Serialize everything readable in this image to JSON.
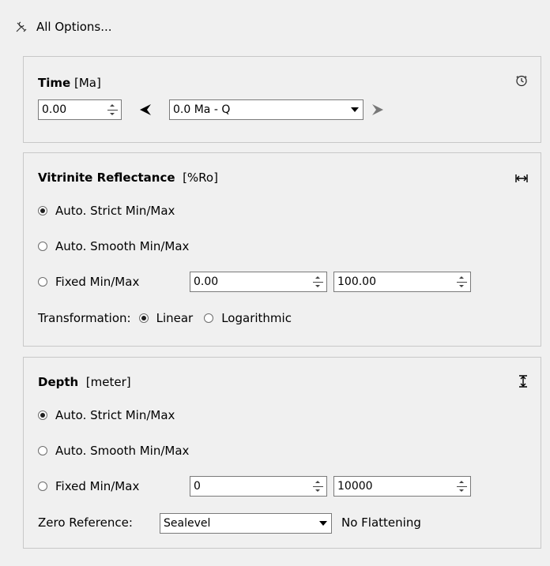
{
  "header": {
    "all_options_label": "All Options...",
    "icon": "wrench-screwdriver-icon"
  },
  "time": {
    "title_bold": "Time",
    "title_unit": "[Ma]",
    "value": "0.00",
    "selected_age": "0.0 Ma - Q",
    "corner_icon": "clock-icon"
  },
  "vitrinite": {
    "title_bold": "Vitrinite Reflectance",
    "title_unit": "[%Ro]",
    "corner_icon": "horizontal-fit-icon",
    "options": [
      "Auto. Strict Min/Max",
      "Auto. Smooth Min/Max",
      "Fixed Min/Max"
    ],
    "selected_option": "Auto. Strict Min/Max",
    "fixed_min": "0.00",
    "fixed_max": "100.00",
    "transformation_label": "Transformation:",
    "transformation_options": [
      "Linear",
      "Logarithmic"
    ],
    "selected_transformation": "Linear"
  },
  "depth": {
    "title_bold": "Depth",
    "title_unit": "[meter]",
    "corner_icon": "vertical-fit-icon",
    "options": [
      "Auto. Strict Min/Max",
      "Auto. Smooth Min/Max",
      "Fixed Min/Max"
    ],
    "selected_option": "Auto. Strict Min/Max",
    "fixed_min": "0",
    "fixed_max": "10000",
    "zero_reference_label": "Zero Reference:",
    "zero_reference_value": "Sealevel",
    "flattening_label": "No Flattening"
  }
}
